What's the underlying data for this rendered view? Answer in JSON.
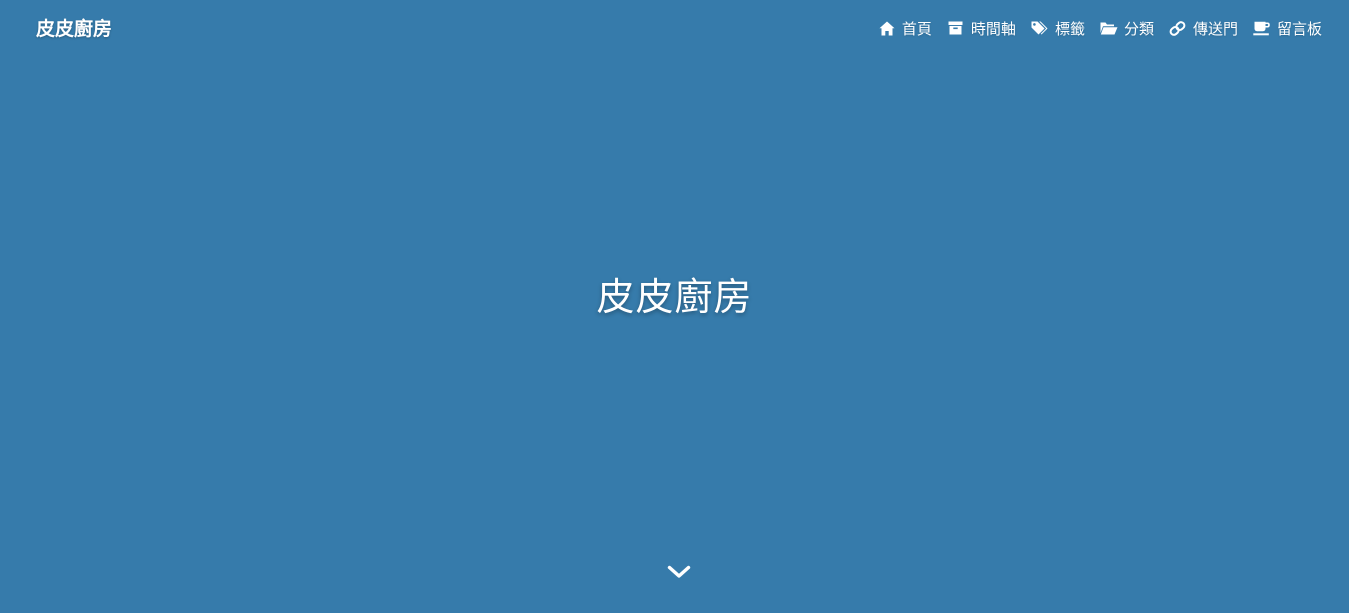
{
  "site": {
    "brand": "皮皮廚房",
    "title": "皮皮廚房"
  },
  "menu": [
    {
      "label": "首頁",
      "icon": "home-icon"
    },
    {
      "label": "時間軸",
      "icon": "archive-icon"
    },
    {
      "label": "標籤",
      "icon": "tags-icon"
    },
    {
      "label": "分類",
      "icon": "folder-open-icon"
    },
    {
      "label": "傳送門",
      "icon": "link-icon"
    },
    {
      "label": "留言板",
      "icon": "coffee-icon"
    }
  ],
  "scroll_indicator": {
    "icon": "chevron-down-icon"
  },
  "colors": {
    "background": "#367bab",
    "text": "#ffffff"
  }
}
